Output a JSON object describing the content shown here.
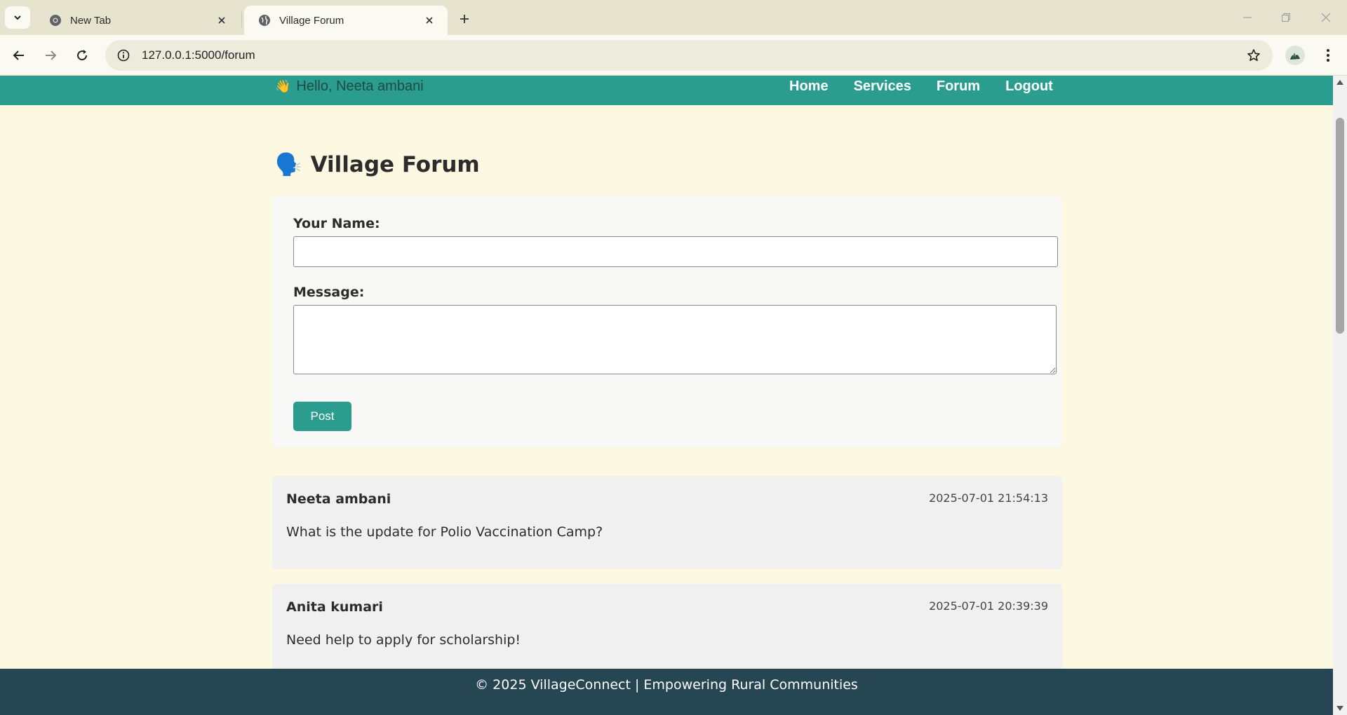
{
  "browser": {
    "tabs": [
      {
        "title": "New Tab",
        "icon": "chrome-icon",
        "active": false
      },
      {
        "title": "Village Forum",
        "icon": "globe-icon",
        "active": true
      }
    ],
    "url": "127.0.0.1:5000/forum"
  },
  "header": {
    "greeting": "Hello, Neeta ambani",
    "greeting_emoji": "👋",
    "nav": [
      {
        "label": "Home"
      },
      {
        "label": "Services"
      },
      {
        "label": "Forum"
      },
      {
        "label": "Logout"
      }
    ],
    "bg_color": "#2a9d8f"
  },
  "page": {
    "title": "Village Forum",
    "title_emoji": "🗣️"
  },
  "form": {
    "name_label": "Your Name:",
    "name_value": "",
    "message_label": "Message:",
    "message_value": "",
    "submit_label": "Post"
  },
  "posts": [
    {
      "author": "Neeta ambani",
      "timestamp": "2025-07-01 21:54:13",
      "message": "What is the update for Polio Vaccination Camp?"
    },
    {
      "author": "Anita kumari",
      "timestamp": "2025-07-01 20:39:39",
      "message": "Need help to apply for scholarship!"
    }
  ],
  "footer": {
    "text": "© 2025 VillageConnect | Empowering Rural Communities",
    "bg_color": "#264653"
  }
}
